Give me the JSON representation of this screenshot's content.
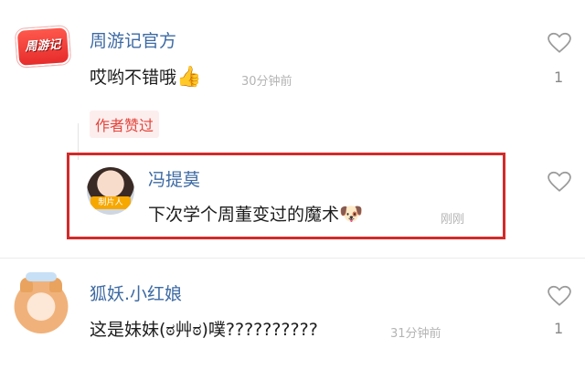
{
  "comments": [
    {
      "username": "周游记官方",
      "content": "哎哟不错哦",
      "emoji": "👍",
      "time": "30分钟前",
      "likes": "1",
      "badge": "作者赞过",
      "avatar_logo_text": "周游记"
    },
    {
      "username": "冯提莫",
      "content": "下次学个周董变过的魔术",
      "emoji": "🐶",
      "time": "刚刚",
      "avatar_tag": "制片人"
    },
    {
      "username": "狐妖.小红娘",
      "content": "这是妹妹(ಠ艸ಠ)噗??????????",
      "time": "31分钟前",
      "likes": "1"
    }
  ],
  "colors": {
    "username": "#3d6aa3",
    "highlight_border": "#d42a2a",
    "badge_text": "#e2463c"
  },
  "icons": [
    "heart-outline-icon",
    "thumbs-up-emoji",
    "doge-emoji"
  ]
}
